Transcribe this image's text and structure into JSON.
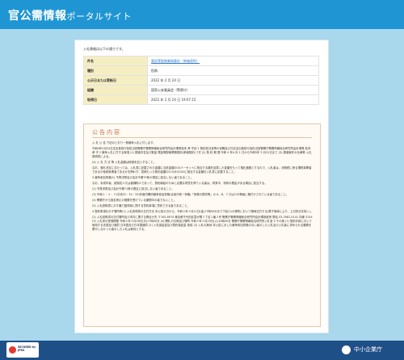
{
  "header": {
    "title_main": "官公需情報",
    "title_sub": "ポータルサイト"
  },
  "card": {
    "intro": "入札情報は以下の通りです。",
    "rows": [
      {
        "key": "件名",
        "value": "電話等配線業務委託（単価契約）",
        "link": true
      },
      {
        "key": "種別",
        "value": "役務",
        "link": false
      },
      {
        "key": "公示日または更新日",
        "value": "2022 年 2 月 24 日",
        "link": false
      },
      {
        "key": "組織",
        "value": "国家公安委員会（警察庁）",
        "link": false
      },
      {
        "key": "取得日",
        "value": "2022 年 2 月 24 日 19:07:15",
        "link": false
      }
    ]
  },
  "notice": {
    "title": "公告内容",
    "paragraphs": [
      "入 札 公 告 下記のとおり一般競争入札に付します。",
      "令和4年2月24日支出負担行為担当官警察庁警察情報総合研究所会計課長松本 孝 守記 1 契約担当官等の官職及び氏名支出負担行為担当官警察庁警察情報総合研究所会計課長 松本 孝 守 2 競争入札に付する事項 (1) 調達件名及び数量 電話等配線業務委託(単価契約) 7式 (2) 契 約 期 間 令和 4 年4 月 1 日から令和5年 3 月31日まで (3) 調達案件の仕様等 入札説明書による。",
      "(4) 入 札 方 法 等 入札金額は総価を記入すること。",
      "なお、落札決定に当たっては、入札書に記載された金額に当該金額の10パーセントに相当する額を加算した金額をもって落札価格とするので、入札者は、消費税に係る課税事業者であるか免税事業者であるかを問わず、見積もった契約金額の110分の100に相当する金額を入札書に記載すること。",
      "3 競争参加資格(1) 予算決算及び会計令第70条の規定に該当しない者であること。",
      "なお、未成年者、被保佐人又は被補助人であって、契約締結のために必要な同意を得ている者は、同条中、特別の理由がある場合に該当する。",
      "(2) 予算決算及び会計令第71条の規定に該当しない者であること。",
      "(3) 令和１・２・３(平成31・32・33)年度内閣府競争参加資格(全省庁統一資格)「役務の提供等」の A、B、Ｃ又はＤの等級に格付けされている者であること。",
      "(4) 警察庁から指名停止の措置を受けている期間中の者でないこと。",
      "(5) 入札説明書に示す暴力団排除に関する誓約事項に誓約できる者であること。",
      "4 契約条項を示す場所等(1) 入札説明書の交付方法 本公告の日から、令和４年３月11日(金)17時00分まで下記(2)の場所において随時交付する(電子媒体により、土日祝日を除く)。",
      "(2) 入札説明書の交付場所及び本件に関する問合せ先 〒100-8974 東京都千代田区霞が関２丁目１番２号 警察庁警察情報総合研究所会計課用度係 電話 03-3581-0141 内線 3154 (3) 入札書の受領期限 令和４年３月28日(月)17時00分 (4) 開札の日時及び場所 令和４年３月29日(火)10時00分 警察庁警察情報総合研究所入札室 5 その他 (1) 契約手続において使用する言語及び通貨 日本語及び日本国通貨 (2) 入札保証金及び契約保証金 免除 (3) 入札の無効 本公告に示した競争参加資格のない者のした入札及び入札者に求められる義務を履行しなかった者のした入札は無効とする。"
    ]
  },
  "footer": {
    "badge_text": "SECURED by JPRS",
    "brand": "中小企業庁"
  },
  "colors": {
    "header": "#1f96d3",
    "background": "#a9d7ec",
    "footer": "#1f4f87",
    "notice_title": "#c6744a"
  }
}
